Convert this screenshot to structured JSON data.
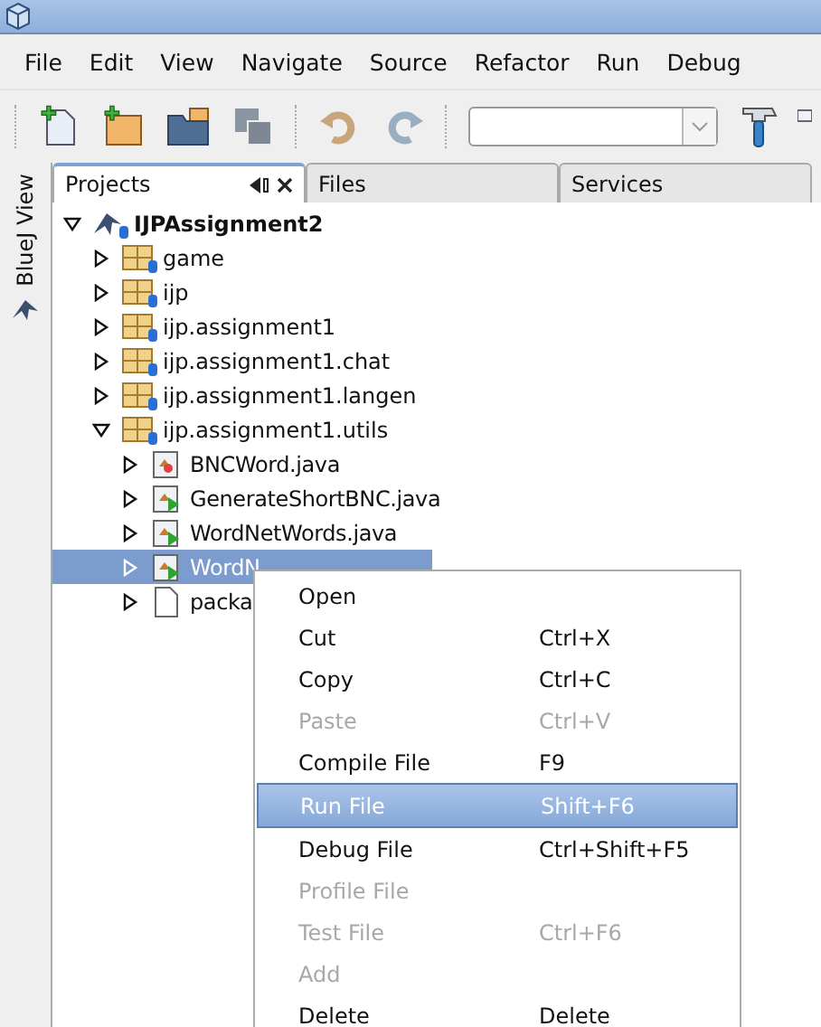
{
  "menu_bar": [
    "File",
    "Edit",
    "View",
    "Navigate",
    "Source",
    "Refactor",
    "Run",
    "Debug"
  ],
  "side_tab": {
    "label": "BlueJ View"
  },
  "tabs": [
    {
      "label": "Projects",
      "selected": true
    },
    {
      "label": "Files",
      "selected": false
    },
    {
      "label": "Services",
      "selected": false
    }
  ],
  "tree": [
    {
      "label": "IJPAssignment2",
      "kind": "project",
      "expanded": true,
      "selected": false,
      "children": [
        {
          "label": "game",
          "kind": "package",
          "expanded": false,
          "selected": false
        },
        {
          "label": "ijp",
          "kind": "package",
          "expanded": false,
          "selected": false
        },
        {
          "label": "ijp.assignment1",
          "kind": "package",
          "expanded": false,
          "selected": false
        },
        {
          "label": "ijp.assignment1.chat",
          "kind": "package",
          "expanded": false,
          "selected": false
        },
        {
          "label": "ijp.assignment1.langen",
          "kind": "package",
          "expanded": false,
          "selected": false
        },
        {
          "label": "ijp.assignment1.utils",
          "kind": "package",
          "expanded": true,
          "selected": false,
          "children": [
            {
              "label": "BNCWord.java",
              "kind": "class",
              "expanded": false,
              "selected": false
            },
            {
              "label": "GenerateShortBNC.java",
              "kind": "main",
              "expanded": false,
              "selected": false
            },
            {
              "label": "WordNetWords.java",
              "kind": "main",
              "expanded": false,
              "selected": false
            },
            {
              "label": "WordN",
              "kind": "main",
              "expanded": false,
              "selected": true
            },
            {
              "label": "packa",
              "kind": "file",
              "expanded": false,
              "selected": false
            }
          ]
        }
      ]
    }
  ],
  "context_menu": [
    {
      "label": "Open",
      "disabled": false,
      "selected": false
    },
    {
      "label": "Cut",
      "shortcut": "Ctrl+X",
      "disabled": false,
      "selected": false
    },
    {
      "label": "Copy",
      "shortcut": "Ctrl+C",
      "disabled": false,
      "selected": false
    },
    {
      "label": "Paste",
      "shortcut": "Ctrl+V",
      "disabled": true,
      "selected": false
    },
    {
      "label": "Compile File",
      "shortcut": "F9",
      "disabled": false,
      "selected": false
    },
    {
      "label": "Run File",
      "shortcut": "Shift+F6",
      "disabled": false,
      "selected": true
    },
    {
      "label": "Debug File",
      "shortcut": "Ctrl+Shift+F5",
      "disabled": false,
      "selected": false
    },
    {
      "label": "Profile File",
      "disabled": true,
      "selected": false
    },
    {
      "label": "Test File",
      "shortcut": "Ctrl+F6",
      "disabled": true,
      "selected": false
    },
    {
      "label": "Add",
      "disabled": true,
      "selected": false
    },
    {
      "label": "Delete",
      "shortcut": "Delete",
      "disabled": false,
      "selected": false
    }
  ]
}
